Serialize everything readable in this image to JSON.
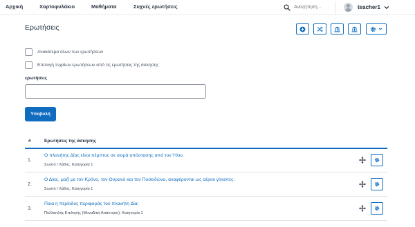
{
  "nav": {
    "items": [
      {
        "label": "Αρχική"
      },
      {
        "label": "Χαρτοφυλάκιο"
      },
      {
        "label": "Μαθήματα"
      },
      {
        "label": "Συχνές ερωτήσεις"
      }
    ],
    "search_placeholder": "Αναζήτηση...",
    "search_icon": "search-icon",
    "user_name": "teacher1",
    "user_menu_icon": "chevron-down-icon"
  },
  "page": {
    "title": "Ερωτήσεις",
    "toolbar": [
      {
        "icon": "plus-circle-icon"
      },
      {
        "icon": "shuffle-icon"
      },
      {
        "icon": "bank-icon"
      },
      {
        "icon": "bank-icon"
      },
      {
        "icon": "gear-icon",
        "caret": "chevron-down-icon"
      }
    ],
    "accent_color": "#0f6cbf"
  },
  "options": {
    "shuffle_all": "Ανακάτεμα όλων των ερωτήσεων",
    "random_select": "Επιλογή τυχαίων ερωτήσεων από τις ερωτήσεις της άσκησης"
  },
  "questions_field": {
    "label": "ερωτήσεις",
    "value": ""
  },
  "submit_label": "Υποβολή",
  "table": {
    "headers": [
      "#",
      "Ερωτήσεις της άσκησης"
    ],
    "rows": [
      {
        "num": "1.",
        "question": "Ο πλανήτης Δίας είναι πέμπτος σε σειρά απόστασης από τον Ήλιο.",
        "meta": "Σωστό / Λάθος. Κατηγορία 1"
      },
      {
        "num": "2.",
        "question": "Ο Δίας, μαζί με τον Κρόνο, τον Ουρανό και τον Ποσειδώνα, αναφέρονται ως αέριοι γίγαντες.",
        "meta": "Σωστό / Λάθος. Κατηγορία 1"
      },
      {
        "num": "3.",
        "question": "Ποια η περίοδος περιφοράς του πλανήτη Δία;",
        "meta": "Πολλαπλής Επιλογής (Μοναδική Απάντηση). Κατηγορία 1"
      }
    ]
  }
}
